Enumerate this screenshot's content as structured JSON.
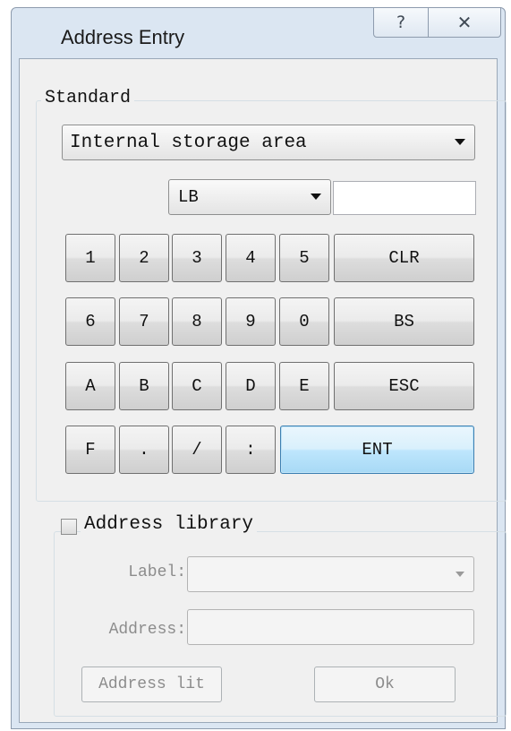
{
  "window": {
    "title": "Address Entry",
    "help_icon": "?",
    "close_icon": "✕"
  },
  "standard": {
    "group_label": "Standard",
    "area_select": "Internal storage area",
    "device_select": "LB",
    "address_value": ""
  },
  "keypad": {
    "rows": [
      [
        "1",
        "2",
        "3",
        "4",
        "5",
        "CLR"
      ],
      [
        "6",
        "7",
        "8",
        "9",
        "0",
        "BS"
      ],
      [
        "A",
        "B",
        "C",
        "D",
        "E",
        "ESC"
      ],
      [
        "F",
        ".",
        "/",
        ":",
        "ENT"
      ]
    ]
  },
  "library": {
    "checkbox_label": "Address library",
    "checked": false,
    "label_caption": "Label:",
    "label_value": "",
    "address_caption": "Address:",
    "address_value": "",
    "library_button": "Address lit",
    "ok_button": "Ok"
  }
}
